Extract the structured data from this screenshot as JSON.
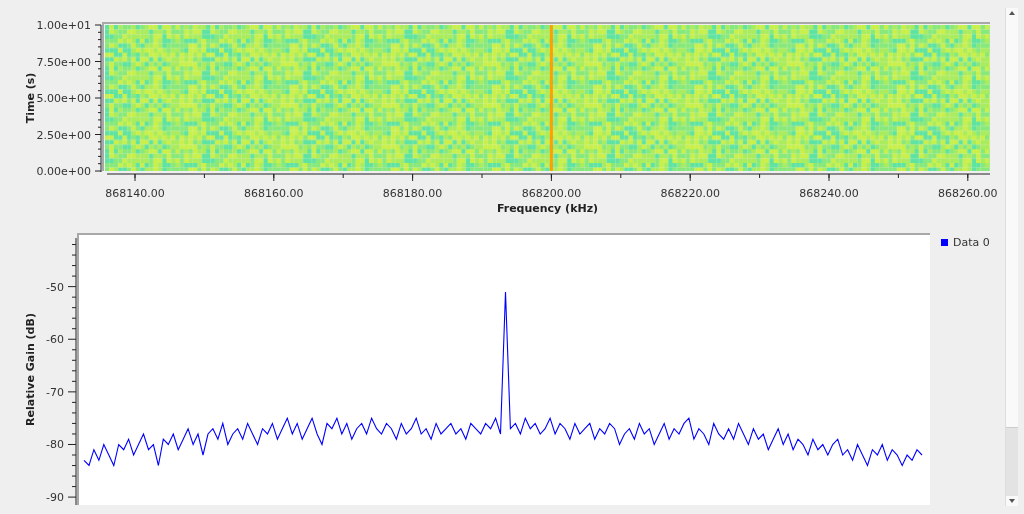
{
  "waterfall": {
    "ylabel": "Time (s)",
    "xlabel": "Frequency (kHz)",
    "yticks": [
      "1.00e+01",
      "7.50e+00",
      "5.00e+00",
      "2.50e+00",
      "0.00e+00"
    ],
    "xticks": [
      "868140.00",
      "868160.00",
      "868180.00",
      "868200.00",
      "868220.00",
      "868240.00",
      "868260.00"
    ]
  },
  "spectrum": {
    "chart_data": {
      "type": "line",
      "ylabel": "Relative Gain (dB)",
      "ylim": [
        -91.5,
        -40
      ],
      "yticks": [
        -90,
        -80,
        -70,
        -60,
        -50
      ],
      "series": [
        {
          "name": "Data 0",
          "color": "#0000ff",
          "values": [
            -83,
            -84,
            -81,
            -83,
            -80,
            -82,
            -84,
            -80,
            -81,
            -79,
            -82,
            -80,
            -78,
            -81,
            -80,
            -84,
            -79,
            -80,
            -78,
            -81,
            -79,
            -77,
            -80,
            -78,
            -82,
            -78,
            -77,
            -79,
            -76,
            -80,
            -78,
            -77,
            -79,
            -76,
            -78,
            -80,
            -77,
            -78,
            -76,
            -79,
            -77,
            -75,
            -78,
            -76,
            -79,
            -77,
            -75,
            -78,
            -80,
            -76,
            -77,
            -75,
            -78,
            -76,
            -79,
            -77,
            -76,
            -78,
            -75,
            -77,
            -78,
            -76,
            -77,
            -79,
            -76,
            -78,
            -77,
            -75,
            -78,
            -77,
            -79,
            -76,
            -78,
            -77,
            -76,
            -78,
            -77,
            -79,
            -76,
            -77,
            -78,
            -76,
            -77,
            -75,
            -78,
            -51,
            -77,
            -76,
            -78,
            -75,
            -77,
            -76,
            -78,
            -77,
            -75,
            -78,
            -76,
            -77,
            -79,
            -76,
            -78,
            -77,
            -76,
            -79,
            -77,
            -78,
            -76,
            -77,
            -80,
            -78,
            -77,
            -79,
            -76,
            -78,
            -77,
            -80,
            -78,
            -76,
            -79,
            -77,
            -78,
            -76,
            -75,
            -79,
            -77,
            -78,
            -80,
            -76,
            -78,
            -79,
            -77,
            -79,
            -76,
            -78,
            -80,
            -77,
            -79,
            -78,
            -81,
            -79,
            -77,
            -80,
            -78,
            -81,
            -79,
            -80,
            -82,
            -79,
            -81,
            -80,
            -82,
            -80,
            -79,
            -82,
            -81,
            -83,
            -80,
            -82,
            -84,
            -81,
            -82,
            -80,
            -83,
            -81,
            -82,
            -84,
            -82,
            -83,
            -81,
            -82
          ]
        }
      ]
    }
  }
}
